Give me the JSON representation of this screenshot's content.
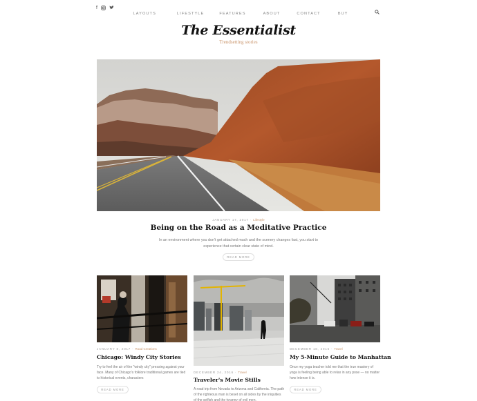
{
  "social": {
    "facebook": "f",
    "instagram": "◘",
    "twitter": "✓"
  },
  "nav": [
    "LAYOUTS",
    "LIFESTYLE",
    "FEATURES",
    "ABOUT",
    "CONTACT",
    "BUY"
  ],
  "site": {
    "title": "The Essentialist",
    "tagline": "Trendsetting stories"
  },
  "featured": {
    "date": "JANUARY 17, 2017",
    "category": "Lifestyle",
    "title": "Being on the Road as a Meditative Practice",
    "excerpt": "In an environment where you don't get attached much and the scenery changes fast, you start to experience that certain clear state of mind.",
    "button": "READ MORE"
  },
  "posts": [
    {
      "date": "JANUARY 8, 2017",
      "category": "Road Creations",
      "title": "Chicago: Windy City Stories",
      "excerpt": "Try to feel the air of the \"windy city\" pressing against your face. Many of Chicago's folklore traditional games are tied to historical events, characters",
      "button": "READ MORE"
    },
    {
      "date": "DECEMBER 24, 2016",
      "category": "Travel",
      "title": "Traveler's Movie Stills",
      "excerpt": "A road trip from Nevada to Arizona and California. The path of the righteous man is beset on all sides by the iniquities of the selfish and the tyranny of evil men.",
      "button": "READ MORE"
    },
    {
      "date": "DECEMBER 18, 2016",
      "category": "Travel",
      "title": "My 5-Minute Guide to Manhattan",
      "excerpt": "Once my yoga teacher told me that the true mastery of yoga is feeling being able to relax in any pose — no matter how intense it is.",
      "button": "READ MORE"
    }
  ],
  "colors": {
    "accent": "#c9946a",
    "text": "#111111",
    "muted": "#777777"
  }
}
